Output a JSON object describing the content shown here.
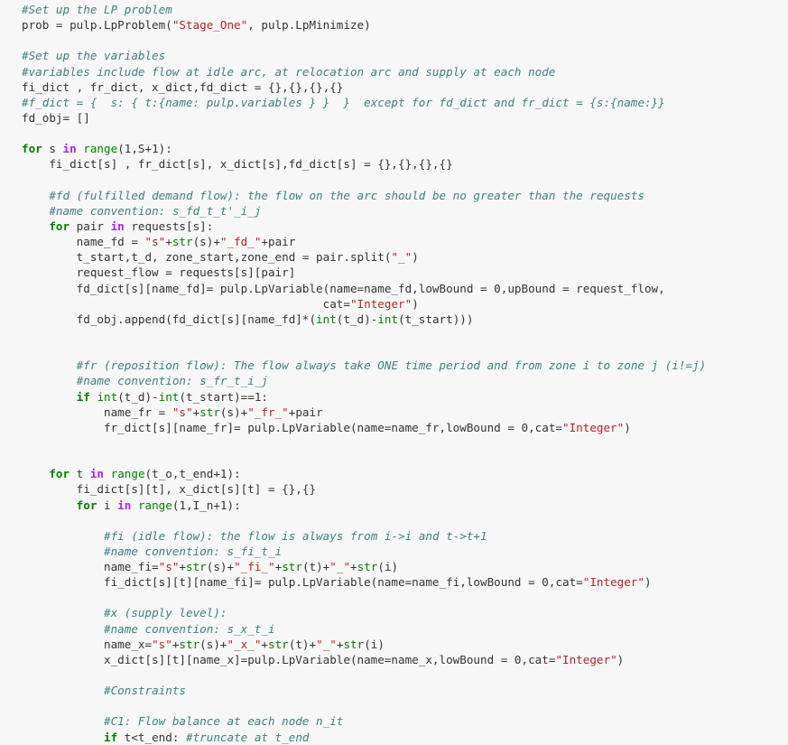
{
  "cell": {
    "language": "python",
    "lines": [
      [
        {
          "t": "cm",
          "v": "#Set up the LP problem"
        }
      ],
      [
        {
          "t": "",
          "v": "prob = pulp.LpProblem("
        },
        {
          "t": "str",
          "v": "\"Stage_One\""
        },
        {
          "t": "",
          "v": ", pulp.LpMinimize)"
        }
      ],
      [],
      [
        {
          "t": "cm",
          "v": "#Set up the variables"
        }
      ],
      [
        {
          "t": "cm",
          "v": "#variables include flow at idle arc, at relocation arc and supply at each node"
        }
      ],
      [
        {
          "t": "",
          "v": "fi_dict , fr_dict, x_dict,fd_dict = {},{},{},{}"
        }
      ],
      [
        {
          "t": "cm",
          "v": "#f_dict = {  s: { t:{name: pulp.variables } }  }  except for fd_dict and fr_dict = {s:{name:}}"
        }
      ],
      [
        {
          "t": "",
          "v": "fd_obj= []"
        }
      ],
      [],
      [
        {
          "t": "kw",
          "v": "for"
        },
        {
          "t": "",
          "v": " s "
        },
        {
          "t": "kw2",
          "v": "in"
        },
        {
          "t": "",
          "v": " "
        },
        {
          "t": "bi",
          "v": "range"
        },
        {
          "t": "",
          "v": "(1,S+1):"
        }
      ],
      [
        {
          "t": "",
          "v": "    fi_dict[s] , fr_dict[s], x_dict[s],fd_dict[s] = {},{},{},{}"
        }
      ],
      [],
      [
        {
          "t": "",
          "v": "    "
        },
        {
          "t": "cm",
          "v": "#fd (fulfilled demand flow): the flow on the arc should be no greater than the requests"
        }
      ],
      [
        {
          "t": "",
          "v": "    "
        },
        {
          "t": "cm",
          "v": "#name convention: s_fd_t_t'_i_j"
        }
      ],
      [
        {
          "t": "",
          "v": "    "
        },
        {
          "t": "kw",
          "v": "for"
        },
        {
          "t": "",
          "v": " pair "
        },
        {
          "t": "kw2",
          "v": "in"
        },
        {
          "t": "",
          "v": " requests[s]:"
        }
      ],
      [
        {
          "t": "",
          "v": "        name_fd = "
        },
        {
          "t": "str",
          "v": "\"s\""
        },
        {
          "t": "",
          "v": "+"
        },
        {
          "t": "bi",
          "v": "str"
        },
        {
          "t": "",
          "v": "(s)+"
        },
        {
          "t": "str",
          "v": "\"_fd_\""
        },
        {
          "t": "",
          "v": "+pair"
        }
      ],
      [
        {
          "t": "",
          "v": "        t_start,t_d, zone_start,zone_end = pair.split("
        },
        {
          "t": "str",
          "v": "\"_\""
        },
        {
          "t": "",
          "v": ")"
        }
      ],
      [
        {
          "t": "",
          "v": "        request_flow = requests[s][pair]"
        }
      ],
      [
        {
          "t": "",
          "v": "        fd_dict[s][name_fd]= pulp.LpVariable(name=name_fd,lowBound = 0,upBound = request_flow,"
        }
      ],
      [
        {
          "t": "",
          "v": "                                            cat="
        },
        {
          "t": "str",
          "v": "\"Integer\""
        },
        {
          "t": "",
          "v": ")"
        }
      ],
      [
        {
          "t": "",
          "v": "        fd_obj.append(fd_dict[s][name_fd]*("
        },
        {
          "t": "bi",
          "v": "int"
        },
        {
          "t": "",
          "v": "(t_d)-"
        },
        {
          "t": "bi",
          "v": "int"
        },
        {
          "t": "",
          "v": "(t_start)))"
        }
      ],
      [],
      [],
      [
        {
          "t": "",
          "v": "        "
        },
        {
          "t": "cm",
          "v": "#fr (reposition flow): The flow always take ONE time period and from zone i to zone j (i!=j)"
        }
      ],
      [
        {
          "t": "",
          "v": "        "
        },
        {
          "t": "cm",
          "v": "#name convention: s_fr_t_i_j"
        }
      ],
      [
        {
          "t": "",
          "v": "        "
        },
        {
          "t": "kw",
          "v": "if"
        },
        {
          "t": "",
          "v": " "
        },
        {
          "t": "bi",
          "v": "int"
        },
        {
          "t": "",
          "v": "(t_d)-"
        },
        {
          "t": "bi",
          "v": "int"
        },
        {
          "t": "",
          "v": "(t_start)==1:"
        }
      ],
      [
        {
          "t": "",
          "v": "            name_fr = "
        },
        {
          "t": "str",
          "v": "\"s\""
        },
        {
          "t": "",
          "v": "+"
        },
        {
          "t": "bi",
          "v": "str"
        },
        {
          "t": "",
          "v": "(s)+"
        },
        {
          "t": "str",
          "v": "\"_fr_\""
        },
        {
          "t": "",
          "v": "+pair"
        }
      ],
      [
        {
          "t": "",
          "v": "            fr_dict[s][name_fr]= pulp.LpVariable(name=name_fr,lowBound = 0,cat="
        },
        {
          "t": "str",
          "v": "\"Integer\""
        },
        {
          "t": "",
          "v": ")"
        }
      ],
      [],
      [],
      [
        {
          "t": "",
          "v": "    "
        },
        {
          "t": "kw",
          "v": "for"
        },
        {
          "t": "",
          "v": " t "
        },
        {
          "t": "kw2",
          "v": "in"
        },
        {
          "t": "",
          "v": " "
        },
        {
          "t": "bi",
          "v": "range"
        },
        {
          "t": "",
          "v": "(t_o,t_end+1):"
        }
      ],
      [
        {
          "t": "",
          "v": "        fi_dict[s][t], x_dict[s][t] = {},{}"
        }
      ],
      [
        {
          "t": "",
          "v": "        "
        },
        {
          "t": "kw",
          "v": "for"
        },
        {
          "t": "",
          "v": " i "
        },
        {
          "t": "kw2",
          "v": "in"
        },
        {
          "t": "",
          "v": " "
        },
        {
          "t": "bi",
          "v": "range"
        },
        {
          "t": "",
          "v": "(1,I_n+1):"
        }
      ],
      [],
      [
        {
          "t": "",
          "v": "            "
        },
        {
          "t": "cm",
          "v": "#fi (idle flow): the flow is always from i->i and t->t+1"
        }
      ],
      [
        {
          "t": "",
          "v": "            "
        },
        {
          "t": "cm",
          "v": "#name convention: s_fi_t_i"
        }
      ],
      [
        {
          "t": "",
          "v": "            name_fi="
        },
        {
          "t": "str",
          "v": "\"s\""
        },
        {
          "t": "",
          "v": "+"
        },
        {
          "t": "bi",
          "v": "str"
        },
        {
          "t": "",
          "v": "(s)+"
        },
        {
          "t": "str",
          "v": "\"_fi_\""
        },
        {
          "t": "",
          "v": "+"
        },
        {
          "t": "bi",
          "v": "str"
        },
        {
          "t": "",
          "v": "(t)+"
        },
        {
          "t": "str",
          "v": "\"_\""
        },
        {
          "t": "",
          "v": "+"
        },
        {
          "t": "bi",
          "v": "str"
        },
        {
          "t": "",
          "v": "(i)"
        }
      ],
      [
        {
          "t": "",
          "v": "            fi_dict[s][t][name_fi]= pulp.LpVariable(name=name_fi,lowBound = 0,cat="
        },
        {
          "t": "str",
          "v": "\"Integer\""
        },
        {
          "t": "",
          "v": ")"
        }
      ],
      [],
      [
        {
          "t": "",
          "v": "            "
        },
        {
          "t": "cm",
          "v": "#x (supply level):"
        }
      ],
      [
        {
          "t": "",
          "v": "            "
        },
        {
          "t": "cm",
          "v": "#name convention: s_x_t_i"
        }
      ],
      [
        {
          "t": "",
          "v": "            name_x="
        },
        {
          "t": "str",
          "v": "\"s\""
        },
        {
          "t": "",
          "v": "+"
        },
        {
          "t": "bi",
          "v": "str"
        },
        {
          "t": "",
          "v": "(s)+"
        },
        {
          "t": "str",
          "v": "\"_x_\""
        },
        {
          "t": "",
          "v": "+"
        },
        {
          "t": "bi",
          "v": "str"
        },
        {
          "t": "",
          "v": "(t)+"
        },
        {
          "t": "str",
          "v": "\"_\""
        },
        {
          "t": "",
          "v": "+"
        },
        {
          "t": "bi",
          "v": "str"
        },
        {
          "t": "",
          "v": "(i)"
        }
      ],
      [
        {
          "t": "",
          "v": "            x_dict[s][t][name_x]=pulp.LpVariable(name=name_x,lowBound = 0,cat="
        },
        {
          "t": "str",
          "v": "\"Integer\""
        },
        {
          "t": "",
          "v": ")"
        }
      ],
      [],
      [
        {
          "t": "",
          "v": "            "
        },
        {
          "t": "cm",
          "v": "#Constraints"
        }
      ],
      [],
      [
        {
          "t": "",
          "v": "            "
        },
        {
          "t": "cm",
          "v": "#C1: Flow balance at each node n_it"
        }
      ],
      [
        {
          "t": "",
          "v": "            "
        },
        {
          "t": "kw",
          "v": "if"
        },
        {
          "t": "",
          "v": " t<t_end: "
        },
        {
          "t": "cm",
          "v": "#truncate at t_end"
        }
      ]
    ]
  },
  "colors": {
    "background": "#f7f7f7",
    "text": "#333333",
    "keyword": "#008000",
    "operator_keyword": "#aa22ff",
    "builtin": "#008000",
    "string": "#ba2121",
    "comment": "#408080"
  }
}
